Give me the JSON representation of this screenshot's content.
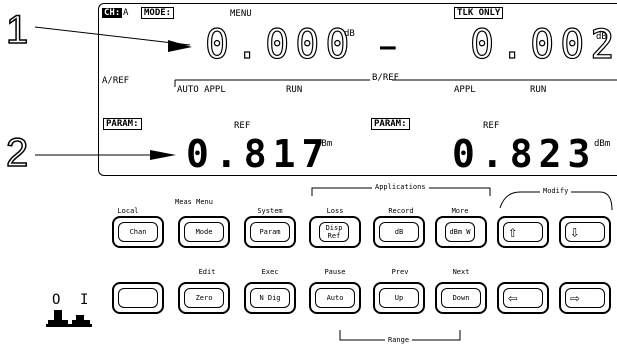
{
  "callouts": [
    "1",
    "2"
  ],
  "display": {
    "channel_label": "CH:",
    "channel_value": "A",
    "mode_label": "MODE:",
    "mode_value": "MENU",
    "tlk_status": "TLK ONLY",
    "reading_a": "0.000",
    "reading_a_unit": "dB",
    "separator": "–",
    "reading_b": "0.002",
    "reading_b_unit": "dB",
    "a_ref_label": "A/REF",
    "b_ref_label": "B/REF",
    "a_soft_labels": [
      "AUTO APPL",
      "RUN"
    ],
    "b_soft_labels": [
      "APPL",
      "RUN"
    ],
    "param_label": "PARAM:",
    "param_ref_a": "REF",
    "param_ref_b": "REF",
    "param_value_a": "0.817",
    "param_value_a_unit": "dBm",
    "param_value_b": "0.823",
    "param_value_b_unit": "dBm"
  },
  "keypad": {
    "group_applications": "Applications",
    "group_modify": "Modify",
    "group_range": "Range",
    "top_shift_labels": [
      "Local",
      "Meas Menu",
      "System",
      "Loss",
      "Record",
      "More"
    ],
    "top_keys": [
      {
        "label": "Chan"
      },
      {
        "label": "Mode"
      },
      {
        "label": "Param"
      },
      {
        "label": "Disp Ref"
      },
      {
        "label": "dB"
      },
      {
        "label": "dBm W"
      }
    ],
    "bottom_shift_labels": [
      "",
      "Edit",
      "Exec",
      "Pause",
      "Prev",
      "Next"
    ],
    "bottom_keys": [
      {
        "label": ""
      },
      {
        "label": "Zero"
      },
      {
        "label": "N Dig"
      },
      {
        "label": "Auto"
      },
      {
        "label": "Up"
      },
      {
        "label": "Down"
      }
    ],
    "arrow_keys": {
      "up": "⇧",
      "down": "⇩",
      "left": "⇦",
      "right": "⇨"
    },
    "power_labels": [
      "O",
      "I"
    ]
  }
}
